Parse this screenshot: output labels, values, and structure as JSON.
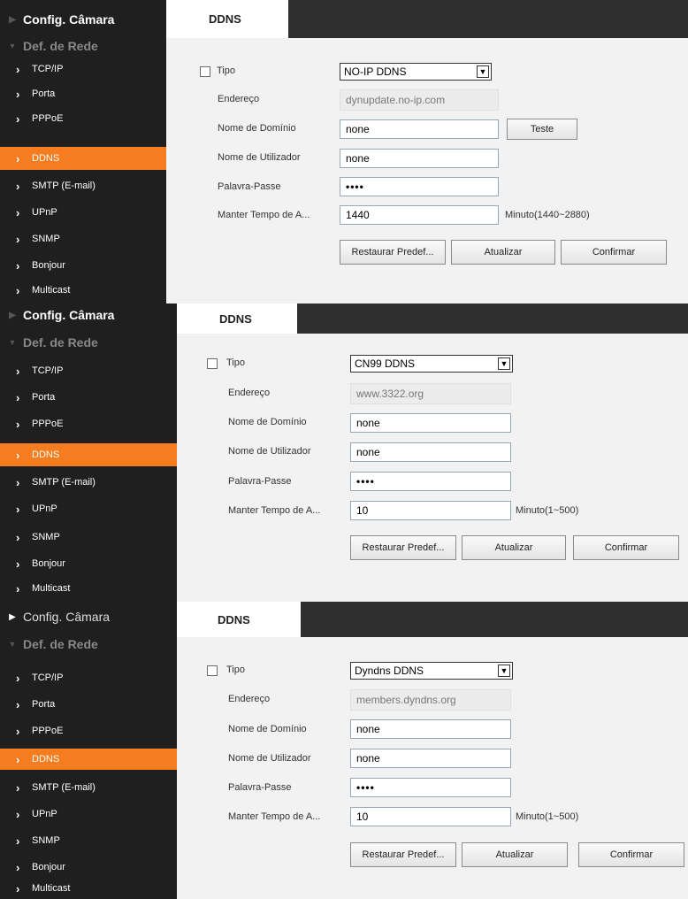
{
  "panels": [
    {
      "sidebar": {
        "camera_config": "Config. Câmara",
        "network_settings": "Def. de Rede",
        "items": [
          "TCP/IP",
          "Porta",
          "PPPoE",
          "DDNS",
          "SMTP (E-mail)",
          "UPnP",
          "SNMP",
          "Bonjour",
          "Multicast"
        ],
        "active": "DDNS"
      },
      "tab": "DDNS",
      "form": {
        "type_label": "Tipo",
        "type_value": "NO-IP DDNS",
        "address_label": "Endereço",
        "address_value": "dynupdate.no-ip.com",
        "domain_label": "Nome de Domínio",
        "domain_value": "none",
        "test_button": "Teste",
        "user_label": "Nome de Utilizador",
        "user_value": "none",
        "password_label": "Palavra-Passe",
        "password_value": "••••",
        "keep_label": "Manter Tempo de A...",
        "keep_value": "1440",
        "keep_hint": "Minuto(1440~2880)",
        "restore_button": "Restaurar Predef...",
        "refresh_button": "Atualizar",
        "confirm_button": "Confirmar"
      }
    },
    {
      "sidebar": {
        "camera_config": "Config. Câmara",
        "network_settings": "Def. de Rede",
        "items": [
          "TCP/IP",
          "Porta",
          "PPPoE",
          "DDNS",
          "SMTP (E-mail)",
          "UPnP",
          "SNMP",
          "Bonjour",
          "Multicast"
        ],
        "active": "DDNS"
      },
      "tab": "DDNS",
      "form": {
        "type_label": "Tipo",
        "type_value": "CN99 DDNS",
        "address_label": "Endereço",
        "address_value": "www.3322.org",
        "domain_label": "Nome de Domínio",
        "domain_value": "none",
        "user_label": "Nome de Utilizador",
        "user_value": "none",
        "password_label": "Palavra-Passe",
        "password_value": "••••",
        "keep_label": "Manter Tempo de A...",
        "keep_value": "10",
        "keep_hint": "Minuto(1~500)",
        "restore_button": "Restaurar Predef...",
        "refresh_button": "Atualizar",
        "confirm_button": "Confirmar"
      }
    },
    {
      "sidebar": {
        "camera_config": "Config. Câmara",
        "network_settings": "Def. de Rede",
        "items": [
          "TCP/IP",
          "Porta",
          "PPPoE",
          "DDNS",
          "SMTP (E-mail)",
          "UPnP",
          "SNMP",
          "Bonjour",
          "Multicast"
        ],
        "active": "DDNS"
      },
      "tab": "DDNS",
      "form": {
        "type_label": "Tipo",
        "type_value": "Dyndns DDNS",
        "address_label": "Endereço",
        "address_value": "members.dyndns.org",
        "domain_label": "Nome de Domínio",
        "domain_value": "none",
        "user_label": "Nome de Utilizador",
        "user_value": "none",
        "password_label": "Palavra-Passe",
        "password_value": "••••",
        "keep_label": "Manter Tempo de A...",
        "keep_value": "10",
        "keep_hint": "Minuto(1~500)",
        "restore_button": "Restaurar Predef...",
        "refresh_button": "Atualizar",
        "confirm_button": "Confirmar"
      }
    }
  ],
  "colors": {
    "accent": "#f57c1f",
    "sidebar_bg": "#1f1f1f",
    "content_bg": "#f2f2f2"
  }
}
